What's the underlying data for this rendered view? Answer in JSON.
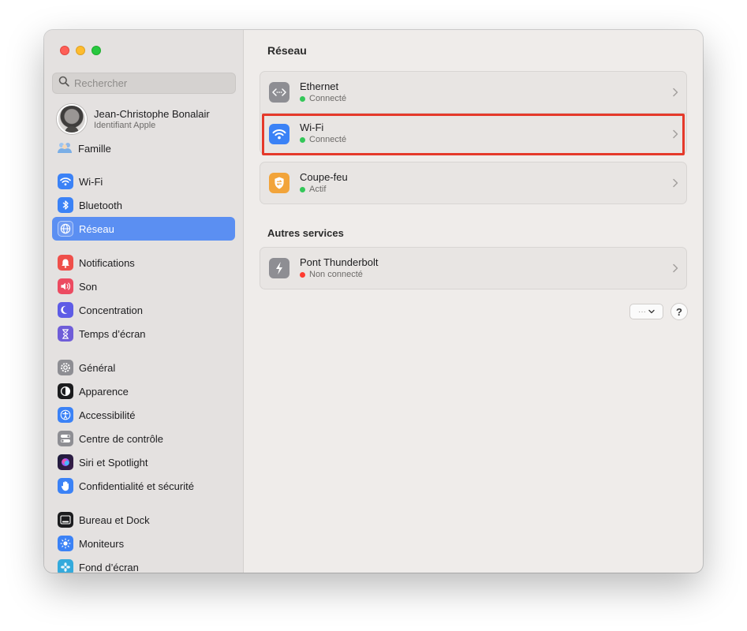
{
  "window_controls": [
    "close",
    "minimize",
    "zoom"
  ],
  "search": {
    "placeholder": "Rechercher",
    "icon": "search-icon"
  },
  "profile": {
    "name": "Jean-Christophe Bonalair",
    "subtitle": "Identifiant Apple"
  },
  "famille": {
    "label": "Famille"
  },
  "sidebar": {
    "group1": [
      {
        "label": "Wi-Fi",
        "icon": "wifi-icon"
      },
      {
        "label": "Bluetooth",
        "icon": "bluetooth-icon"
      },
      {
        "label": "Réseau",
        "icon": "globe-icon",
        "active": true
      }
    ],
    "group2": [
      {
        "label": "Notifications",
        "icon": "bell-icon"
      },
      {
        "label": "Son",
        "icon": "speaker-icon"
      },
      {
        "label": "Concentration",
        "icon": "moon-icon"
      },
      {
        "label": "Temps d’écran",
        "icon": "hourglass-icon"
      }
    ],
    "group3": [
      {
        "label": "Général",
        "icon": "gear-icon"
      },
      {
        "label": "Apparence",
        "icon": "appearance-icon"
      },
      {
        "label": "Accessibilité",
        "icon": "accessibility-icon"
      },
      {
        "label": "Centre de contrôle",
        "icon": "toggles-icon"
      },
      {
        "label": "Siri et Spotlight",
        "icon": "siri-icon"
      },
      {
        "label": "Confidentialité et sécurité",
        "icon": "hand-icon"
      }
    ],
    "group4": [
      {
        "label": "Bureau et Dock",
        "icon": "dock-icon"
      },
      {
        "label": "Moniteurs",
        "icon": "sun-icon"
      },
      {
        "label": "Fond d’écran",
        "icon": "flower-icon"
      }
    ]
  },
  "main": {
    "title": "Réseau",
    "services": [
      {
        "name": "Ethernet",
        "status": "Connecté",
        "status_color": "#34c759",
        "icon": "ethernet-icon"
      },
      {
        "name": "Wi-Fi",
        "status": "Connecté",
        "status_color": "#34c759",
        "icon": "wifi-icon"
      },
      {
        "name": "Coupe-feu",
        "status": "Actif",
        "status_color": "#34c759",
        "icon": "firewall-icon"
      }
    ],
    "other_title": "Autres services",
    "other_services": [
      {
        "name": "Pont Thunderbolt",
        "status": "Non connecté",
        "status_color": "#ff3b30",
        "icon": "thunderbolt-icon"
      }
    ],
    "more_button": "···",
    "help_button": "?"
  },
  "colors": {
    "accent": "#5b8ff2",
    "highlight": "#e5392a",
    "connected": "#34c759",
    "disconnected": "#ff3b30"
  }
}
